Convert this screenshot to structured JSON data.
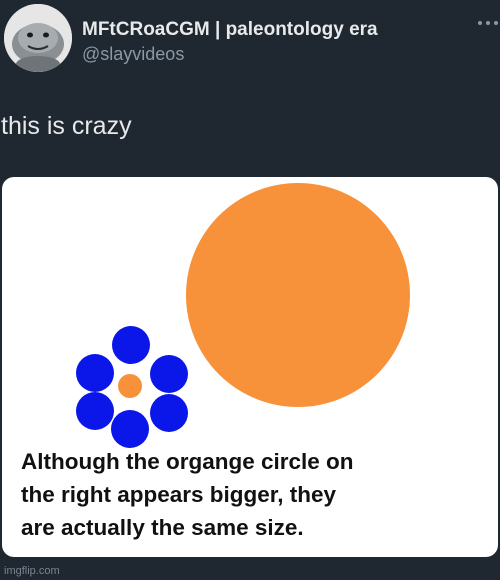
{
  "tweet": {
    "author": {
      "display_name": "MFtCRoaCGM | paleontology era",
      "handle": "@slayvideos",
      "avatar_icon": "plush-creature-avatar"
    },
    "more_icon": "more-dots-icon",
    "text": "this is crazy",
    "media": {
      "caption_lines": [
        "Although the organge circle on",
        "the right appears bigger, they",
        "are actually the same size."
      ],
      "colors": {
        "orange": "#f7923a",
        "blue": "#0a17e8",
        "background": "#ffffff"
      }
    }
  },
  "watermark": "imgflip.com",
  "colors": {
    "page_background": "#1f2731",
    "primary_text": "#e7e9ea",
    "secondary_text": "#8b98a5"
  }
}
